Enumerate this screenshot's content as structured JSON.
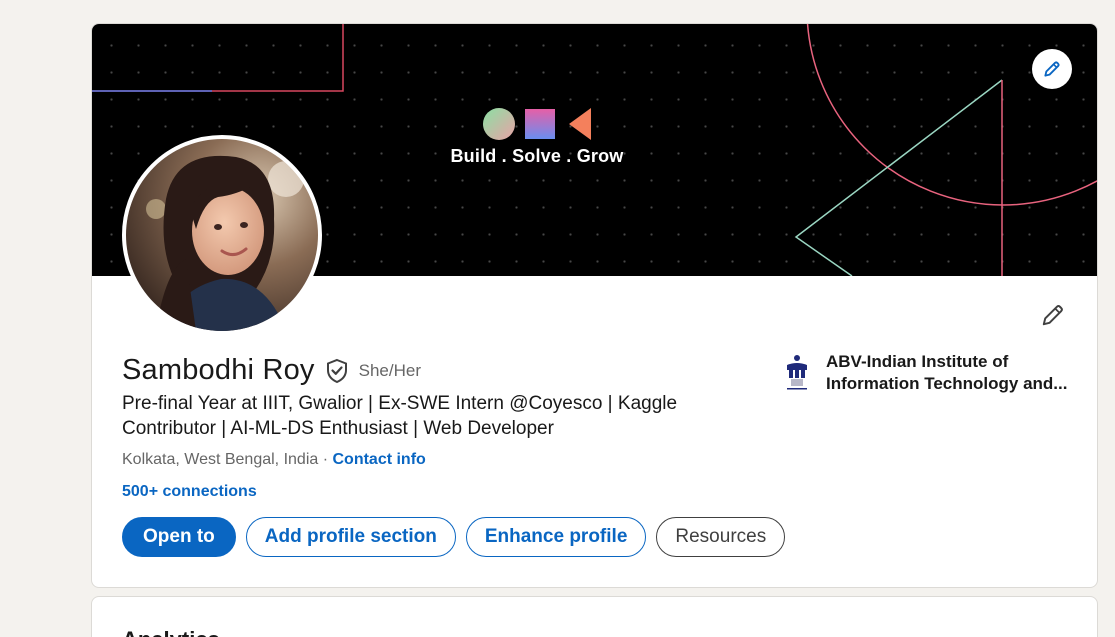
{
  "banner": {
    "brand_text": "Build . Solve . Grow",
    "edit_icon": "pencil-icon",
    "colors": {
      "background": "#000000",
      "circle": "#e8637e",
      "triangle": "#9ad6c2",
      "corner_line": "#d8475f"
    }
  },
  "profile": {
    "name": "Sambodhi Roy",
    "verified_icon": "shield-check-icon",
    "pronouns": "She/Her",
    "headline": "Pre-final Year at IIIT, Gwalior | Ex-SWE Intern @Coyesco | Kaggle Contributor | AI-ML-DS Enthusiast | Web Developer",
    "location": "Kolkata, West Bengal, India",
    "separator": " · ",
    "contact_info": "Contact info",
    "connections": "500+ connections"
  },
  "education": {
    "line1": "ABV-Indian Institute of",
    "line2": "Information Technology and..."
  },
  "actions": {
    "open_to": "Open to",
    "add_profile_section": "Add profile section",
    "enhance_profile": "Enhance profile",
    "resources": "Resources"
  },
  "next_section": {
    "title": "Analytics"
  },
  "colors": {
    "page_bg": "#f4f2ee",
    "accent": "#0a66c2",
    "text": "#191919",
    "muted": "#666666"
  }
}
